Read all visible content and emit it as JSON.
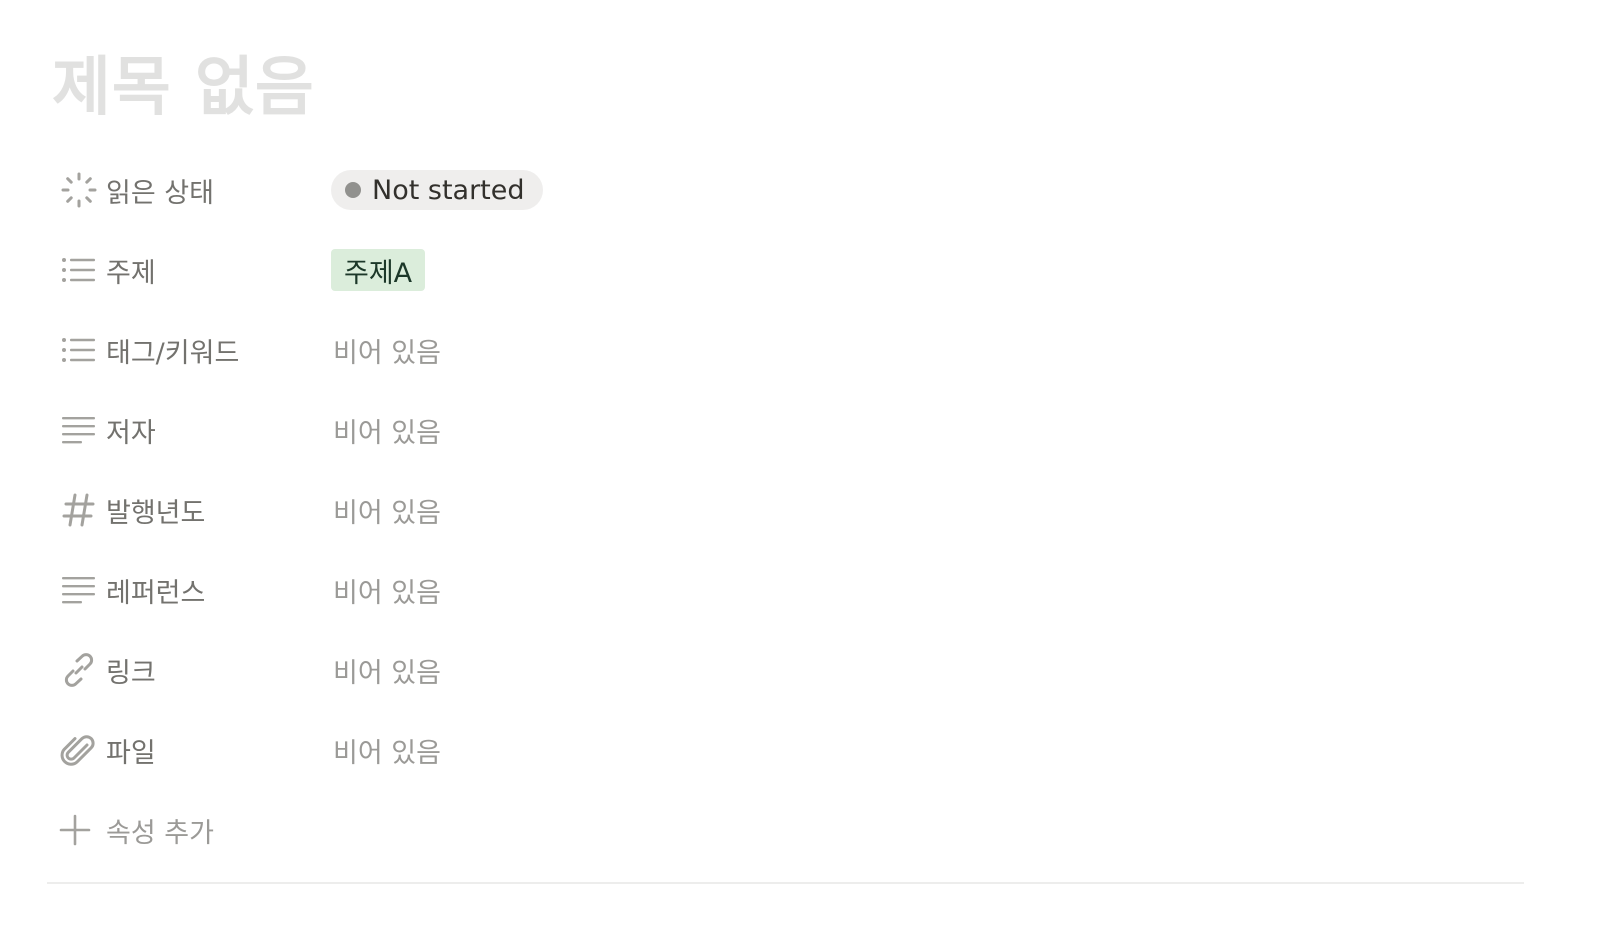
{
  "page": {
    "title": "제목 없음"
  },
  "properties": [
    {
      "label": "읽은 상태",
      "icon": "status-spinner-icon",
      "type": "status",
      "value": "Not started"
    },
    {
      "label": "주제",
      "icon": "list-icon",
      "type": "select",
      "value": "주제A"
    },
    {
      "label": "태그/키워드",
      "icon": "list-icon",
      "type": "multi-select",
      "value": "비어 있음"
    },
    {
      "label": "저자",
      "icon": "text-lines-icon",
      "type": "text",
      "value": "비어 있음"
    },
    {
      "label": "발행년도",
      "icon": "hash-icon",
      "type": "number",
      "value": "비어 있음"
    },
    {
      "label": "레퍼런스",
      "icon": "text-lines-icon",
      "type": "text",
      "value": "비어 있음"
    },
    {
      "label": "링크",
      "icon": "link-icon",
      "type": "url",
      "value": "비어 있음"
    },
    {
      "label": "파일",
      "icon": "paperclip-icon",
      "type": "files",
      "value": "비어 있음"
    }
  ],
  "add_property": {
    "label": "속성 추가",
    "icon": "plus-icon"
  },
  "colors": {
    "title_placeholder": "#e1e1e0",
    "label": "#73726e",
    "empty_value": "#9b9a97",
    "status_bg": "#efeeed",
    "status_dot": "#91918e",
    "tag_bg": "#dbeddb",
    "tag_text": "#1c3829"
  }
}
